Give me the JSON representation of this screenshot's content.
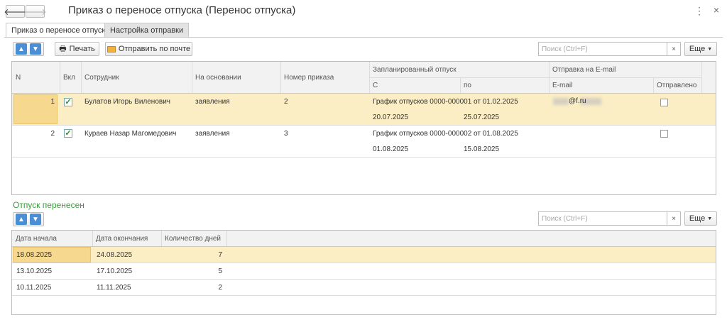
{
  "window": {
    "title": "Приказ о переносе отпуска (Перенос отпуска)",
    "back_icon": "arrow-left",
    "forward_icon": "arrow-right",
    "more_icon": "⋮",
    "close_icon": "×"
  },
  "tabs": [
    {
      "label": "Приказ о переносе отпуска",
      "active": true
    },
    {
      "label": "Настройка отправки",
      "active": false
    }
  ],
  "toolbar": {
    "print_label": "Печать",
    "send_label": "Отправить по почте",
    "search_placeholder": "Поиск (Ctrl+F)",
    "clear_label": "×",
    "more_label": "Еще"
  },
  "main_table": {
    "headers": {
      "n": "N",
      "vkl": "Вкл",
      "employee": "Сотрудник",
      "basis": "На основании",
      "order_no": "Номер приказа",
      "planned": "Запланированный отпуск",
      "from": "С",
      "to": "по",
      "email_group": "Отправка на E-mail",
      "email": "E-mail",
      "sent": "Отправлено"
    },
    "rows": [
      {
        "n": "1",
        "checked": true,
        "employee": "Булатов Игорь Виленович",
        "basis": "заявления",
        "order_no": "2",
        "schedule": "График отпусков 0000-000001 от 01.02.2025",
        "from": "20.07.2025",
        "to": "25.07.2025",
        "email": "@f.ru",
        "sent": false,
        "selected": true
      },
      {
        "n": "2",
        "checked": true,
        "employee": "Кураев Назар Магомедович",
        "basis": "заявления",
        "order_no": "3",
        "schedule": "График отпусков 0000-000002 от 01.08.2025",
        "from": "01.08.2025",
        "to": "15.08.2025",
        "email": "",
        "sent": false,
        "selected": false
      }
    ]
  },
  "moved_section": {
    "title": "Отпуск перенесен",
    "search_placeholder": "Поиск (Ctrl+F)",
    "clear_label": "×",
    "more_label": "Еще",
    "headers": {
      "start": "Дата начала",
      "end": "Дата окончания",
      "days": "Количество дней"
    },
    "rows": [
      {
        "start": "18.08.2025",
        "end": "24.08.2025",
        "days": "7",
        "selected": true
      },
      {
        "start": "13.10.2025",
        "end": "17.10.2025",
        "days": "5",
        "selected": false
      },
      {
        "start": "10.11.2025",
        "end": "11.11.2025",
        "days": "2",
        "selected": false
      }
    ]
  },
  "colors": {
    "accent_blue": "#4a8fd6",
    "selection": "#fbeec5",
    "section_green": "#3c9b3c"
  }
}
